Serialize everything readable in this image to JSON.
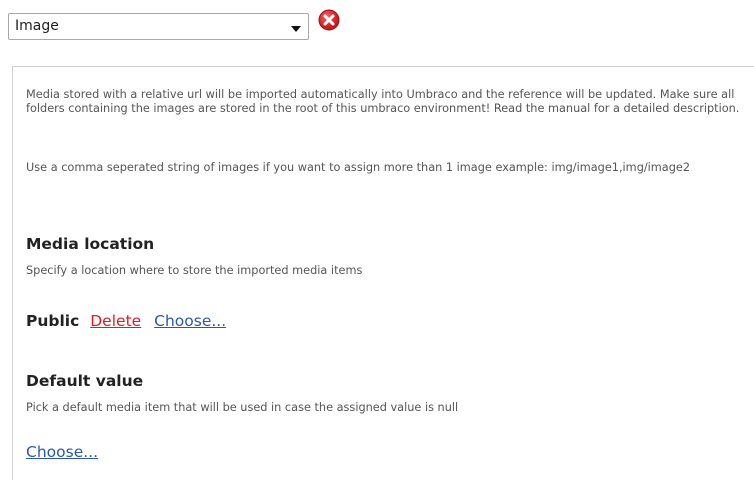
{
  "type_select": {
    "value": "Image"
  },
  "remove_icon": "remove-icon",
  "help": {
    "paragraph_1": "Media stored with a relative url will be imported automatically into Umbraco and the reference will be updated. Make sure all folders containing the images are stored in the root of this umbraco environment! Read the manual for a detailed description.",
    "paragraph_2": "Use a comma seperated string of images if you want to assign more than 1 image example: img/image1,img/image2"
  },
  "media_location": {
    "title": "Media location",
    "description": "Specify a location where to store the imported media items",
    "selected_value": "Public",
    "delete_label": "Delete",
    "choose_label": "Choose..."
  },
  "default_value": {
    "title": "Default value",
    "description": "Pick a default media item that will be used in case the assigned value is null",
    "choose_label": "Choose..."
  },
  "colors": {
    "delete_link": "#e8191a",
    "choose_link": "#2b56b5",
    "remove_icon": "#d9262b"
  }
}
